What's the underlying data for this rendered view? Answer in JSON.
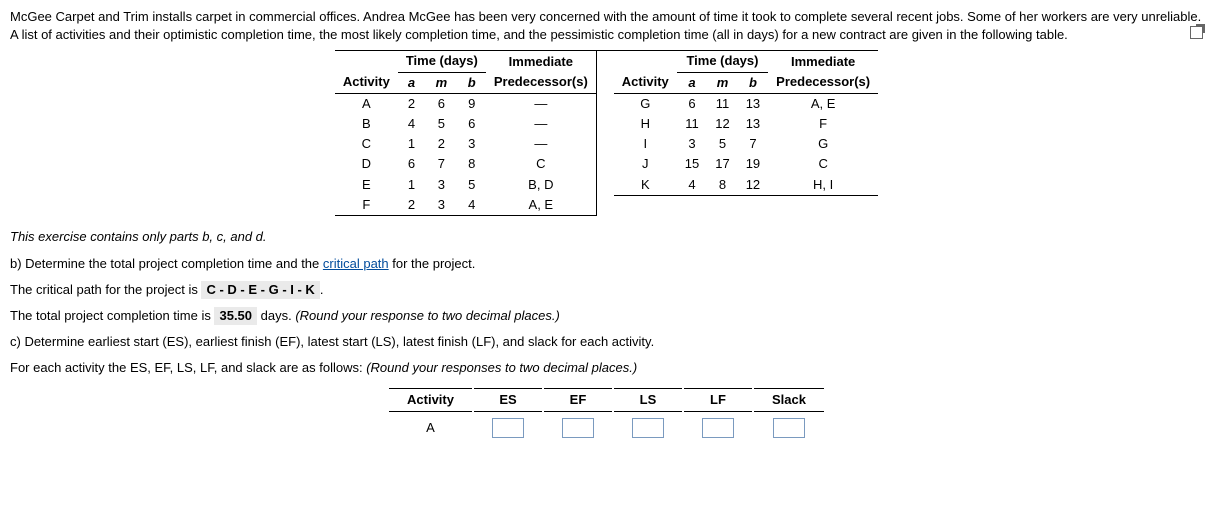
{
  "intro": "McGee Carpet and Trim installs carpet in commercial offices. Andrea McGee has been very concerned with the amount of time it took to complete several recent jobs. Some of her workers are very unreliable. A list of activities and their optimistic completion time, the most likely completion time, and the pessimistic completion time (all in days) for a new contract are given in the following table.",
  "headers": {
    "activity": "Activity",
    "time": "Time (days)",
    "pred": "Immediate Predecessor(s)",
    "a": "a",
    "m": "m",
    "b": "b"
  },
  "left_rows": [
    {
      "act": "A",
      "a": "2",
      "m": "6",
      "b": "9",
      "pred": "—"
    },
    {
      "act": "B",
      "a": "4",
      "m": "5",
      "b": "6",
      "pred": "—"
    },
    {
      "act": "C",
      "a": "1",
      "m": "2",
      "b": "3",
      "pred": "—"
    },
    {
      "act": "D",
      "a": "6",
      "m": "7",
      "b": "8",
      "pred": "C"
    },
    {
      "act": "E",
      "a": "1",
      "m": "3",
      "b": "5",
      "pred": "B, D"
    },
    {
      "act": "F",
      "a": "2",
      "m": "3",
      "b": "4",
      "pred": "A, E"
    }
  ],
  "right_rows": [
    {
      "act": "G",
      "a": "6",
      "m": "11",
      "b": "13",
      "pred": "A, E"
    },
    {
      "act": "H",
      "a": "11",
      "m": "12",
      "b": "13",
      "pred": "F"
    },
    {
      "act": "I",
      "a": "3",
      "m": "5",
      "b": "7",
      "pred": "G"
    },
    {
      "act": "J",
      "a": "15",
      "m": "17",
      "b": "19",
      "pred": "C"
    },
    {
      "act": "K",
      "a": "4",
      "m": "8",
      "b": "12",
      "pred": "H, I"
    }
  ],
  "parts_note": "This exercise contains only parts b, c, and d.",
  "b_q": "b) Determine the total project completion time and the ",
  "b_link": "critical path",
  "b_q2": " for the project.",
  "b_ans1_pre": "The critical path for the project is ",
  "b_ans1_val": "C - D - E - G - I - K",
  "b_ans1_post": ".",
  "b_ans2_pre": "The total project completion time is ",
  "b_ans2_val": "35.50",
  "b_ans2_post": " days. ",
  "round2": "(Round your response to two decimal places.)",
  "c_q": "c) Determine earliest start (ES), earliest finish (EF), latest start (LS), latest finish (LF), and slack for each activity.",
  "c_intro": "For each activity the ES, EF, LS, LF, and slack are as follows: ",
  "round2b": "(Round your responses to two decimal places.)",
  "ans_headers": {
    "activity": "Activity",
    "es": "ES",
    "ef": "EF",
    "ls": "LS",
    "lf": "LF",
    "slack": "Slack"
  },
  "ans_row_act": "A"
}
